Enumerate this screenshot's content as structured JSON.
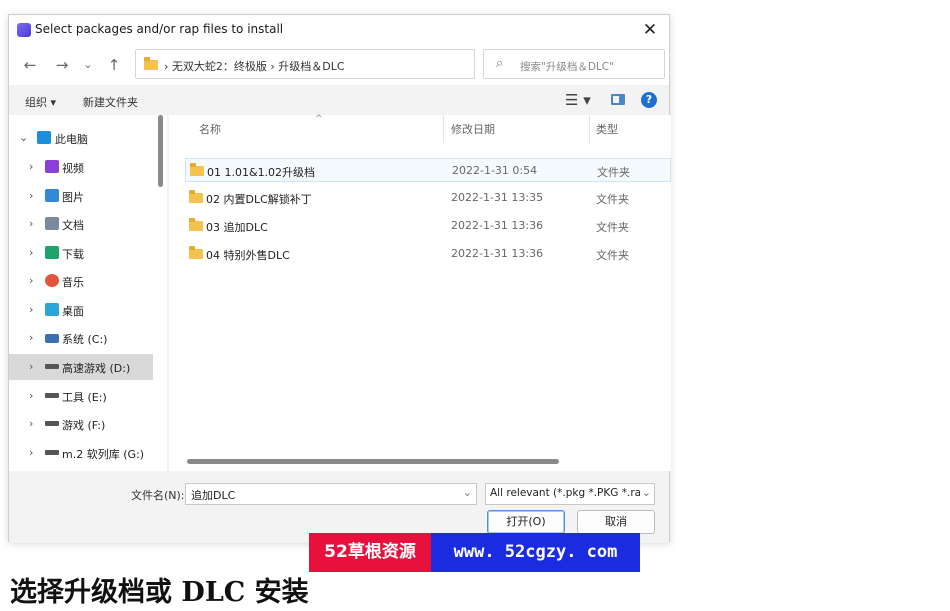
{
  "dialog": {
    "title": "Select packages and/or rap files to install",
    "close_glyph": "✕"
  },
  "nav": {
    "back_glyph": "←",
    "forward_glyph": "→",
    "recent_glyph": "⌄",
    "up_glyph": "↑",
    "address": "›  无双大蛇2：终极版  ›  升级档＆DLC",
    "address_dropdown_glyph": "⌵",
    "refresh_glyph": "↻",
    "search_icon_glyph": "⌕",
    "search_placeholder": "搜索\"升级档＆DLC\""
  },
  "toolbar": {
    "organize": "组织 ▾",
    "new_folder": "新建文件夹",
    "view_glyph": "☰ ▾",
    "help_glyph": "?"
  },
  "sidebar": {
    "items": [
      {
        "label": "此电脑",
        "icon": "pc-icon",
        "color": "#1d8fd8",
        "chev": "⌄"
      },
      {
        "label": "视频",
        "icon": "video-icon",
        "color": "#8a3fd6",
        "chev": "›"
      },
      {
        "label": "图片",
        "icon": "pictures-icon",
        "color": "#2f8ad8",
        "chev": "›"
      },
      {
        "label": "文档",
        "icon": "documents-icon",
        "color": "#7a8a9c",
        "chev": "›"
      },
      {
        "label": "下载",
        "icon": "download-icon",
        "color": "#1ea36b",
        "chev": "›"
      },
      {
        "label": "音乐",
        "icon": "music-icon",
        "color": "#e2553a",
        "chev": "›"
      },
      {
        "label": "桌面",
        "icon": "desktop-icon",
        "color": "#2aa6d8",
        "chev": "›"
      },
      {
        "label": "系统 (C:)",
        "icon": "drive-c-icon",
        "color": "#3b6fb0",
        "chev": "›"
      },
      {
        "label": "高速游戏 (D:)",
        "icon": "drive-icon",
        "color": "#555555",
        "chev": "›"
      },
      {
        "label": "工具 (E:)",
        "icon": "drive-icon",
        "color": "#555555",
        "chev": "›"
      },
      {
        "label": "游戏 (F:)",
        "icon": "drive-icon",
        "color": "#555555",
        "chev": "›"
      },
      {
        "label": "m.2 软列库 (G:)",
        "icon": "drive-icon",
        "color": "#555555",
        "chev": "›"
      }
    ]
  },
  "files": {
    "columns": {
      "name": "名称",
      "date": "修改日期",
      "type": "类型"
    },
    "sort_glyph": "^",
    "rows": [
      {
        "name": "01 1.01&1.02升级档",
        "date": "2022-1-31 0:54",
        "type": "文件夹"
      },
      {
        "name": "02 内置DLC解锁补丁",
        "date": "2022-1-31 13:35",
        "type": "文件夹"
      },
      {
        "name": "03 追加DLC",
        "date": "2022-1-31 13:36",
        "type": "文件夹"
      },
      {
        "name": "04 特别外售DLC",
        "date": "2022-1-31 13:36",
        "type": "文件夹"
      }
    ]
  },
  "footer": {
    "filename_label": "文件名(N):",
    "filename_value": "追加DLC",
    "filter_value": "All relevant (*.pkg *.PKG *.rap",
    "dropdown_glyph": "⌄",
    "open_button": "打开(O)",
    "cancel_button": "取消"
  },
  "banner": {
    "left_text": "52草根资源",
    "right_text": "www. 52cgzy. com",
    "left_color": "#e8113d",
    "right_color": "#1a2be0"
  },
  "caption": "选择升级档或 DLC 安装"
}
